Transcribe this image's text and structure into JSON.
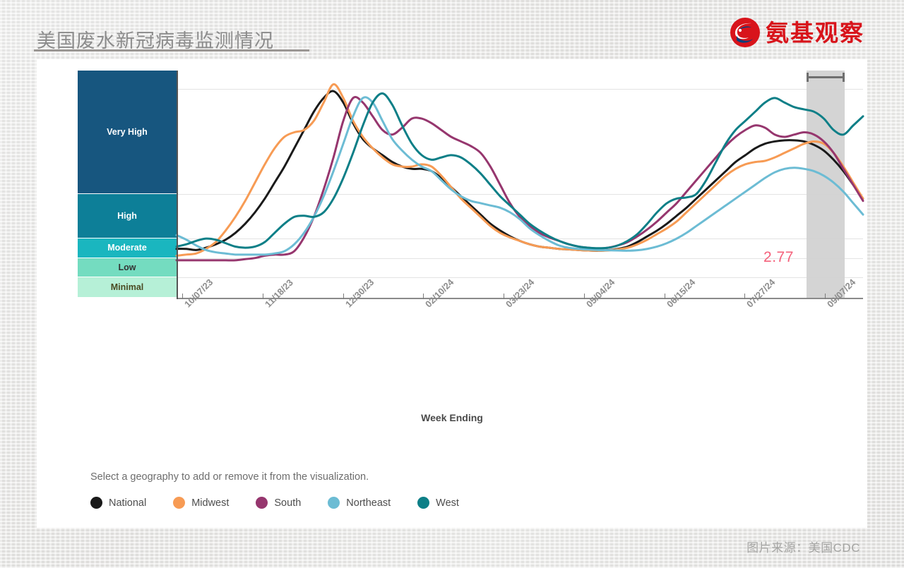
{
  "header": {
    "title": "美国废水新冠病毒监测情况",
    "brand": "氨基观察",
    "brand_colors": {
      "red": "#d8141b",
      "blue": "#0d3f7a"
    }
  },
  "source_note": "图片来源：美国CDC",
  "chart_data": {
    "type": "line",
    "title": "",
    "xlabel": "Week Ending",
    "ylabel": "",
    "grid": true,
    "legend_position": "bottom",
    "legend_hint": "Select a geography to add or remove it from the visualization.",
    "x_tick_labels": [
      "10/07/23",
      "11/18/23",
      "12/30/23",
      "02/10/24",
      "03/23/24",
      "05/04/24",
      "06/15/24",
      "07/27/24",
      "09/07/24"
    ],
    "y_categories": [
      {
        "label": "Very High",
        "color": "#17567f",
        "text_color": "#ffffff",
        "top_pct": 0.0,
        "bottom_pct": 54.0
      },
      {
        "label": "High",
        "color": "#0d7f98",
        "text_color": "#ffffff",
        "top_pct": 54.0,
        "bottom_pct": 73.5
      },
      {
        "label": "Moderate",
        "color": "#1ab6bf",
        "text_color": "#ffffff",
        "top_pct": 73.5,
        "bottom_pct": 82.0
      },
      {
        "label": "Low",
        "color": "#74dcc0",
        "text_color": "#333333",
        "top_pct": 82.0,
        "bottom_pct": 90.4
      },
      {
        "label": "Minimal",
        "color": "#b6f0d7",
        "text_color": "#4a4a22",
        "top_pct": 90.4,
        "bottom_pct": 99.4
      }
    ],
    "gridlines_pct": [
      8.0,
      54.0,
      73.5,
      82.0,
      90.4
    ],
    "annotation": {
      "text": "2.77",
      "color": "#f4607a"
    },
    "provisional_region": {
      "label": "",
      "start_pct": 91.8,
      "end_pct": 97.3,
      "color": "#d2d2d2"
    },
    "series": [
      {
        "name": "National",
        "color": "#1a1a1a",
        "values": [
          22,
          22,
          21.5,
          22.5,
          24,
          26,
          29,
          33,
          38,
          44,
          51,
          58,
          66,
          74,
          82,
          88,
          91,
          86,
          77,
          70,
          66,
          63,
          60,
          58,
          57,
          57,
          56,
          53,
          49,
          45,
          41,
          37,
          33,
          30,
          27.5,
          25.5,
          24,
          23,
          22.5,
          22,
          21.8,
          21.5,
          21.3,
          21.2,
          21.4,
          22,
          23,
          25,
          27.5,
          30,
          33,
          36.5,
          40,
          44,
          48,
          52,
          56,
          60,
          63,
          66,
          68,
          69,
          69.5,
          69.5,
          69,
          67.5,
          65,
          61,
          56,
          50,
          44
        ]
      },
      {
        "name": "Midwest",
        "color": "#f79b54",
        "values": [
          19,
          19.5,
          20,
          22,
          25,
          30,
          36,
          43,
          51,
          59,
          66,
          71,
          73,
          74,
          78,
          86,
          94,
          88,
          78,
          71,
          66,
          62,
          59,
          58,
          58,
          59,
          58,
          54,
          49,
          44,
          40,
          36,
          32,
          29,
          27,
          25.5,
          24,
          23,
          22.5,
          22,
          21.8,
          21.5,
          21.3,
          21.2,
          21.3,
          21.8,
          22.5,
          24,
          26,
          28.5,
          31,
          34,
          38,
          42,
          46,
          50,
          54,
          57,
          59,
          60,
          60.5,
          62,
          64,
          66,
          68,
          69,
          68,
          64,
          58,
          51,
          44
        ]
      },
      {
        "name": "South",
        "color": "#96366e",
        "values": [
          17,
          17,
          17,
          17,
          17,
          17,
          17,
          17.5,
          18,
          19,
          19.5,
          19.5,
          21,
          27,
          36,
          48,
          62,
          78,
          88,
          86,
          80,
          74,
          72,
          75,
          79,
          79,
          77,
          74,
          71,
          69,
          67,
          64,
          58,
          50,
          42,
          36,
          32,
          29,
          27,
          25.5,
          24,
          23,
          22.5,
          22.2,
          22.5,
          23.5,
          25,
          27.5,
          30.5,
          34,
          38,
          42,
          47,
          52,
          57,
          62,
          67,
          71,
          74,
          76,
          75,
          72,
          71,
          72,
          73,
          72,
          69,
          64,
          57,
          50,
          43
        ]
      },
      {
        "name": "Northeast",
        "color": "#6cbcd4",
        "values": [
          28,
          26,
          23.5,
          21.5,
          20.5,
          20,
          19.5,
          19.5,
          19.5,
          19.5,
          20,
          21,
          24,
          29,
          36,
          45,
          56,
          68,
          80,
          88,
          86,
          78,
          70,
          65,
          61,
          58,
          56,
          52,
          48,
          45,
          43,
          42,
          41,
          40,
          38,
          35,
          31,
          28,
          25.5,
          23.5,
          22.5,
          22,
          21.7,
          21.5,
          21.4,
          21.3,
          21.2,
          21.4,
          22,
          23,
          24.5,
          26.5,
          29,
          32,
          35,
          38,
          41,
          44,
          47,
          50,
          53,
          55.5,
          57,
          57.5,
          57,
          56,
          54,
          51,
          47,
          42,
          37
        ]
      },
      {
        "name": "West",
        "color": "#0d7f87",
        "values": [
          23,
          24,
          25.5,
          26.5,
          26,
          24.5,
          23,
          22.5,
          23,
          25,
          29,
          33,
          36,
          36.5,
          36,
          38,
          44,
          53,
          64,
          76,
          86,
          90,
          85,
          76,
          68,
          63,
          61,
          62,
          63,
          62,
          59,
          55,
          50,
          45,
          41,
          37,
          33,
          30,
          27.5,
          25.5,
          24,
          23,
          22.5,
          22.3,
          22.5,
          23.5,
          25.5,
          28.5,
          33,
          38,
          42,
          44,
          44.5,
          46,
          52,
          60,
          68,
          74,
          78,
          82,
          86,
          88,
          86,
          84,
          83,
          82,
          79,
          74,
          72,
          76,
          80
        ]
      }
    ]
  }
}
